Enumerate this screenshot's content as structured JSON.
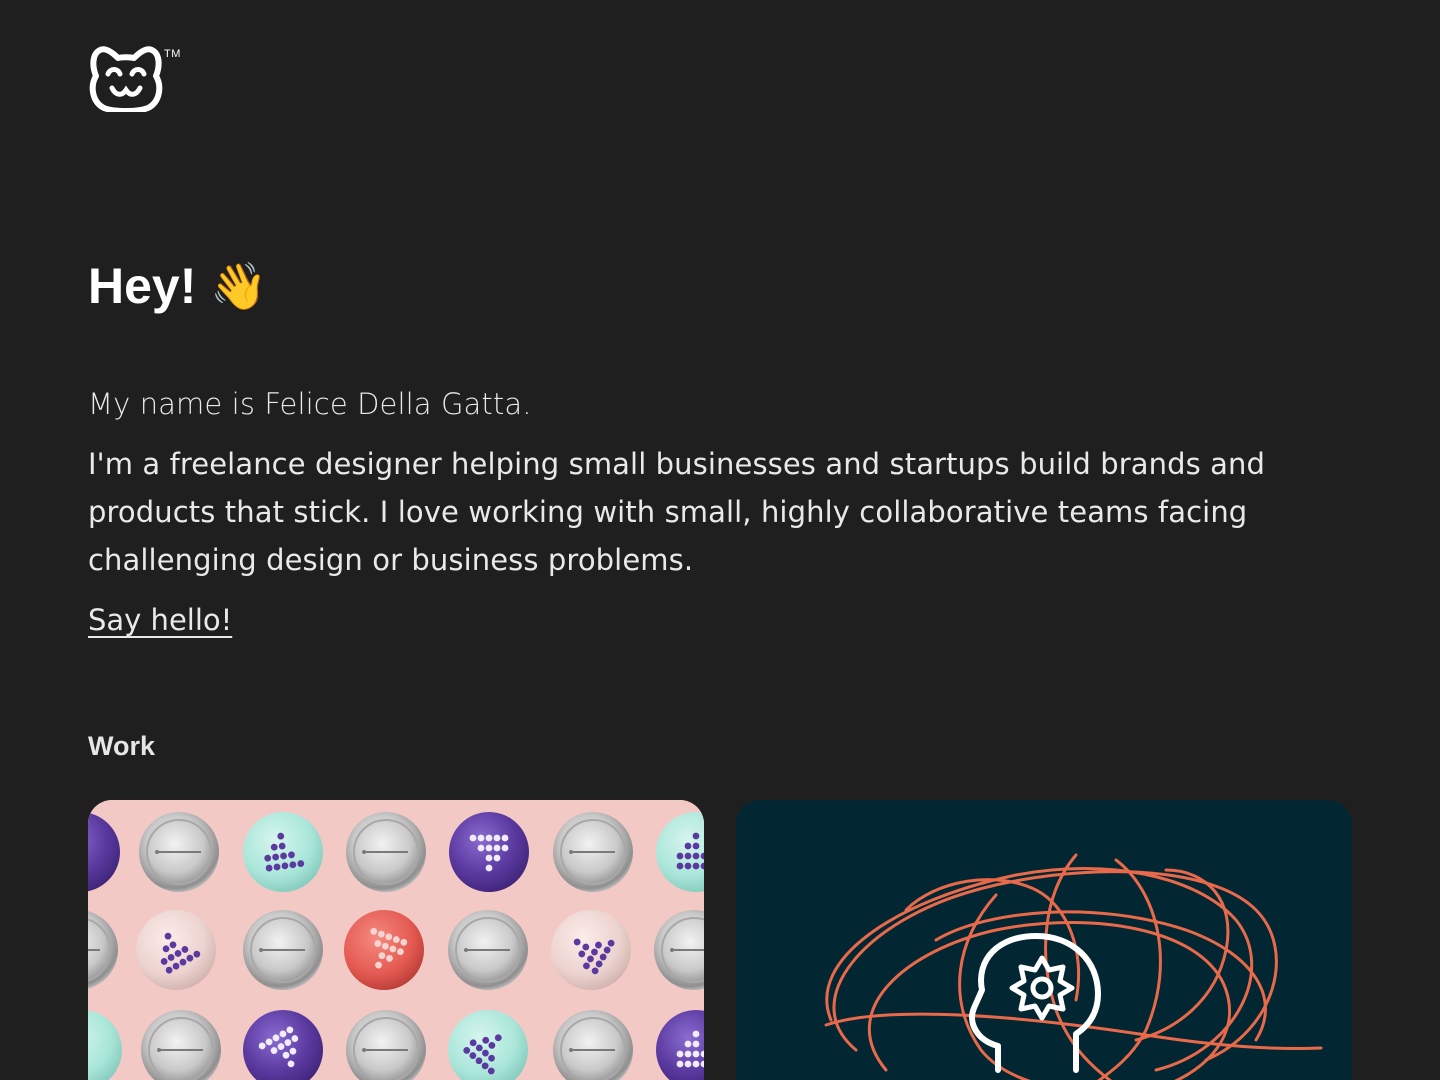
{
  "header": {
    "logo_alt": "Cat face logo",
    "trademark": "TM"
  },
  "hero": {
    "greeting": "Hey!",
    "wave_emoji": "👋",
    "intro": "My name is Felice Della Gatta.",
    "bio": "I'm a freelance designer helping small businesses and startups build brands and products that stick. I love working with small, highly collaborative teams facing challenging design or business problems.",
    "cta_label": "Say hello!"
  },
  "work": {
    "section_title": "Work",
    "projects": [
      {
        "thumbnail": "pin-badges-pattern",
        "colors": {
          "background": "#f3c9c6",
          "purple": "#5b3aa0",
          "mint": "#a9e6d9",
          "red": "#e45a52",
          "silver": "#c9c9c9"
        }
      },
      {
        "thumbnail": "head-with-gear-scribble",
        "colors": {
          "background": "#022632",
          "scribble": "#e86a4a",
          "outline": "#ffffff"
        }
      }
    ]
  },
  "colors": {
    "page_background": "#1f1f1f",
    "text": "#ededed"
  }
}
